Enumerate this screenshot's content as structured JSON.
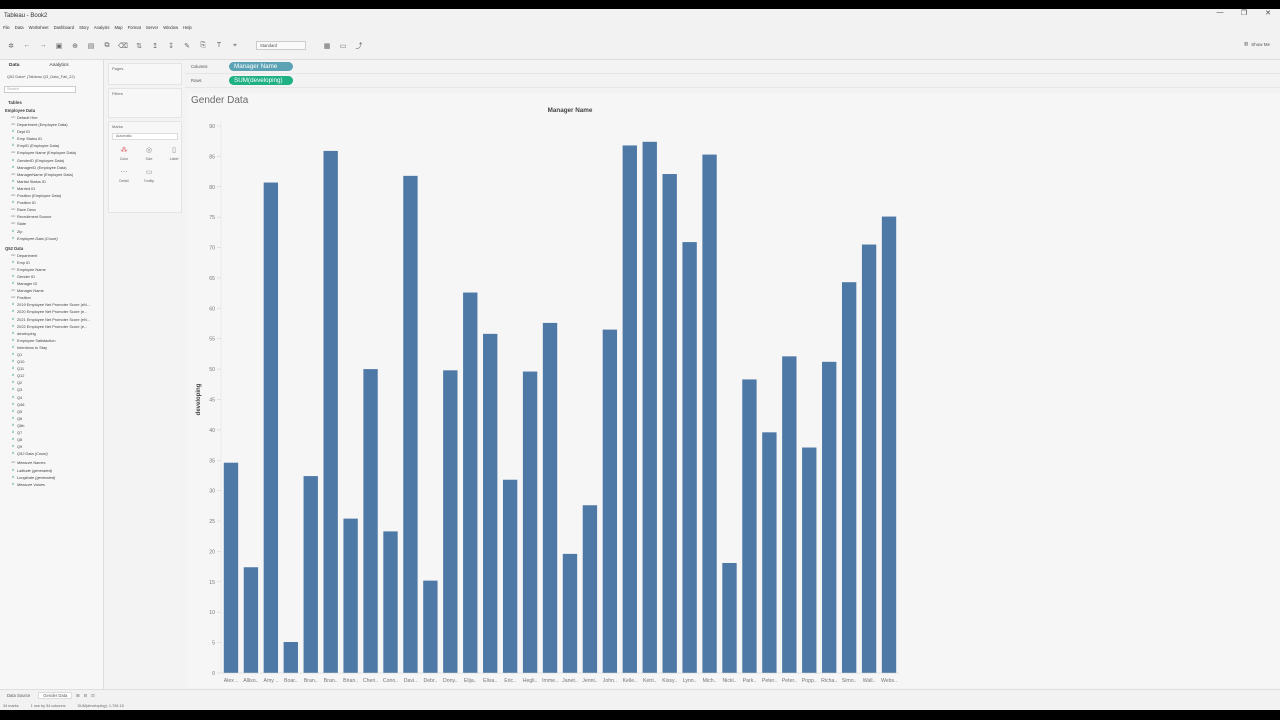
{
  "window": {
    "title": "Tableau - Book2",
    "controls": [
      "—",
      "❐",
      "✕"
    ]
  },
  "menu": [
    "File",
    "Data",
    "Worksheet",
    "Dashboard",
    "Story",
    "Analysis",
    "Map",
    "Format",
    "Server",
    "Window",
    "Help"
  ],
  "toolbar": {
    "fit_select": "Standard",
    "show_me": "Show Me"
  },
  "data_pane": {
    "tab_data": "Data",
    "tab_analytics": "Analytics",
    "source": "Q52 Data+ (Tableau Q3_Data_Fall_22)",
    "search_placeholder": "Search",
    "tables_label": "Tables",
    "group1": "Employee Data",
    "group1_fields": [
      {
        "name": "Default Hire",
        "kind": "d"
      },
      {
        "name": "Department (Employee Data)",
        "kind": "d"
      },
      {
        "name": "Dept ID",
        "kind": "m"
      },
      {
        "name": "Emp Status ID",
        "kind": "m"
      },
      {
        "name": "EmpID (Employee Data)",
        "kind": "m"
      },
      {
        "name": "Employee Name (Employee Data)",
        "kind": "d"
      },
      {
        "name": "GenderID (Employee Data)",
        "kind": "m"
      },
      {
        "name": "ManagerID (Employee Data)",
        "kind": "m"
      },
      {
        "name": "ManagerName (Employee Data)",
        "kind": "d"
      },
      {
        "name": "Marital Status ID",
        "kind": "m"
      },
      {
        "name": "Married ID",
        "kind": "m"
      },
      {
        "name": "Position (Employee Data)",
        "kind": "d"
      },
      {
        "name": "Position ID",
        "kind": "m"
      },
      {
        "name": "Race Desc",
        "kind": "d"
      },
      {
        "name": "Recruitment Source",
        "kind": "d"
      },
      {
        "name": "State",
        "kind": "d"
      },
      {
        "name": "Zip",
        "kind": "m"
      },
      {
        "name": "Employee Data (Count)",
        "kind": "m",
        "italic": true
      }
    ],
    "group2": "Q52 Data",
    "group2_fields": [
      {
        "name": "Department",
        "kind": "d"
      },
      {
        "name": "Emp ID",
        "kind": "m"
      },
      {
        "name": "Employee Name",
        "kind": "d"
      },
      {
        "name": "Gender ID",
        "kind": "m"
      },
      {
        "name": "Manager ID",
        "kind": "m"
      },
      {
        "name": "Manager Name",
        "kind": "d"
      },
      {
        "name": "Position",
        "kind": "d"
      },
      {
        "name": "2019 Employee Net Promoter Score (eN...",
        "kind": "m"
      },
      {
        "name": "2020 Employee Net Promoter Score (e...",
        "kind": "m"
      },
      {
        "name": "2021 Employee Net Promoter Score (eN...",
        "kind": "m"
      },
      {
        "name": "2022 Employee Net Promoter Score (e...",
        "kind": "m"
      },
      {
        "name": "developing",
        "kind": "m"
      },
      {
        "name": "Employee Satisfaction",
        "kind": "m"
      },
      {
        "name": "Intentions to Stay",
        "kind": "m"
      },
      {
        "name": "Q1",
        "kind": "m"
      },
      {
        "name": "Q10",
        "kind": "m"
      },
      {
        "name": "Q11",
        "kind": "m"
      },
      {
        "name": "Q12",
        "kind": "m"
      },
      {
        "name": "Q2",
        "kind": "m"
      },
      {
        "name": "Q3",
        "kind": "m"
      },
      {
        "name": "Q4",
        "kind": "m"
      },
      {
        "name": "Q46",
        "kind": "m"
      },
      {
        "name": "Q5",
        "kind": "m"
      },
      {
        "name": "Q6",
        "kind": "m"
      },
      {
        "name": "Q6b",
        "kind": "m"
      },
      {
        "name": "Q7",
        "kind": "m"
      },
      {
        "name": "Q8",
        "kind": "m"
      },
      {
        "name": "Q9",
        "kind": "m"
      },
      {
        "name": "Q52 Data (Count)",
        "kind": "m",
        "italic": true
      }
    ],
    "extra_fields": [
      {
        "name": "Measure Names",
        "kind": "d",
        "italic": true
      },
      {
        "name": "Latitude (generated)",
        "kind": "m",
        "italic": true
      },
      {
        "name": "Longitude (generated)",
        "kind": "m",
        "italic": true
      },
      {
        "name": "Measure Values",
        "kind": "m",
        "italic": true
      }
    ]
  },
  "shelves": {
    "pages": "Pages",
    "filters": "Filters",
    "marks": "Marks",
    "mark_type": "Automatic",
    "mark_buttons": [
      "Color",
      "Size",
      "Label",
      "Detail",
      "Tooltip"
    ],
    "columns_label": "Columns",
    "columns_pill": "Manager Name",
    "rows_label": "Rows",
    "rows_pill": "SUM(developing)"
  },
  "view": {
    "title": "Gender Data"
  },
  "chart_data": {
    "type": "bar",
    "title": "Manager Name",
    "xlabel": "",
    "ylabel": "developing",
    "ylim": [
      0,
      90
    ],
    "yticks": [
      0,
      5,
      10,
      15,
      20,
      25,
      30,
      35,
      40,
      45,
      50,
      55,
      60,
      65,
      70,
      75,
      80,
      85,
      90
    ],
    "grid": false,
    "bar_color": "#4e79a7",
    "categories": [
      "Alex ..",
      "Alliso..",
      "Amy ..",
      "Boar..",
      "Bran..",
      "Bran..",
      "Brian..",
      "Cheri..",
      "Cono..",
      "Davi..",
      "Debr..",
      "Dony..",
      "Elija..",
      "Elisa..",
      "Eric..",
      "Hegli..",
      "Imme..",
      "Janet..",
      "Jenni..",
      "John..",
      "Kelle..",
      "Ketri..",
      "Kissy..",
      "Lynn..",
      "Mich..",
      "Nicki..",
      "Park..",
      "Peter..",
      "Peter..",
      "Popp..",
      "Richa..",
      "Simo..",
      "Wall..",
      "Webs.."
    ],
    "values": [
      34.6,
      17.4,
      80.7,
      5.1,
      32.4,
      85.9,
      25.4,
      50.0,
      23.3,
      81.8,
      15.2,
      49.8,
      62.6,
      55.8,
      31.8,
      49.6,
      57.6,
      19.6,
      27.6,
      56.5,
      86.8,
      87.4,
      82.1,
      70.9,
      85.3,
      18.1,
      48.3,
      39.6,
      52.1,
      37.1,
      51.2,
      64.3,
      70.5,
      75.1
    ]
  },
  "status": {
    "tabs": [
      "Data Source",
      "Gender Data"
    ],
    "active_tab": "Gender Data",
    "marks": "34 marks",
    "rows_cols": "1 row by 34 columns",
    "sum": "SUM(developing): 1,726.15"
  }
}
